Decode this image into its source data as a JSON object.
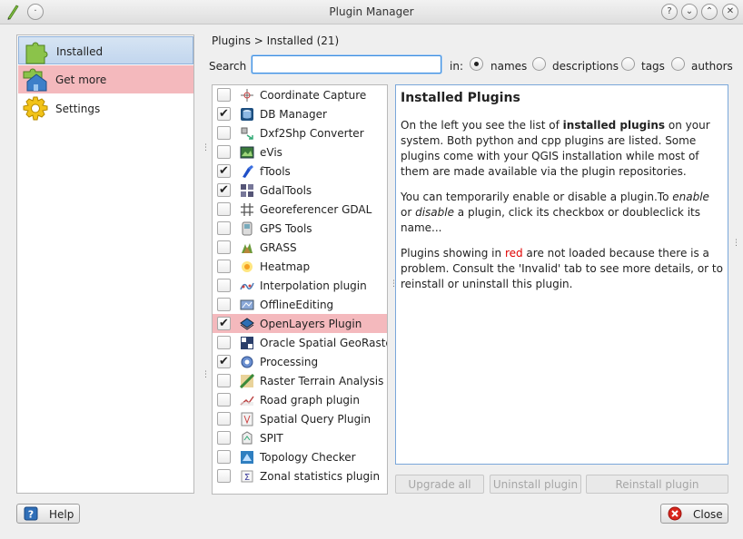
{
  "window": {
    "title": "Plugin Manager",
    "help_btn": "?",
    "min_btn": "⌄",
    "max_btn": "⌃",
    "close_btn": "✕",
    "menu_btn": "·"
  },
  "nav": {
    "items": [
      {
        "label": "Installed",
        "icon": "puzzle-icon",
        "state": "selected"
      },
      {
        "label": "Get more",
        "icon": "puzzle-house-icon",
        "state": "highlight"
      },
      {
        "label": "Settings",
        "icon": "gear-icon",
        "state": "normal"
      }
    ]
  },
  "breadcrumb": "Plugins > Installed (21)",
  "search": {
    "label": "Search",
    "value": "",
    "in_label": "in:",
    "options": [
      {
        "label": "names",
        "selected": true
      },
      {
        "label": "descriptions",
        "selected": false
      },
      {
        "label": "tags",
        "selected": false
      },
      {
        "label": "authors",
        "selected": false
      }
    ]
  },
  "plugins": [
    {
      "name": "Coordinate Capture",
      "checked": false,
      "icon": "crosshair-icon"
    },
    {
      "name": "DB Manager",
      "checked": true,
      "icon": "database-icon"
    },
    {
      "name": "Dxf2Shp Converter",
      "checked": false,
      "icon": "dxf-convert-icon"
    },
    {
      "name": "eVis",
      "checked": false,
      "icon": "evis-icon"
    },
    {
      "name": "fTools",
      "checked": true,
      "icon": "ftools-icon"
    },
    {
      "name": "GdalTools",
      "checked": true,
      "icon": "gdal-icon"
    },
    {
      "name": "Georeferencer GDAL",
      "checked": false,
      "icon": "georeferencer-icon"
    },
    {
      "name": "GPS Tools",
      "checked": false,
      "icon": "gps-icon"
    },
    {
      "name": "GRASS",
      "checked": false,
      "icon": "grass-icon"
    },
    {
      "name": "Heatmap",
      "checked": false,
      "icon": "heatmap-icon"
    },
    {
      "name": "Interpolation plugin",
      "checked": false,
      "icon": "interpolation-icon"
    },
    {
      "name": "OfflineEditing",
      "checked": false,
      "icon": "offline-editing-icon"
    },
    {
      "name": "OpenLayers Plugin",
      "checked": true,
      "icon": "openlayers-icon",
      "invalid": true
    },
    {
      "name": "Oracle Spatial GeoRaster",
      "checked": false,
      "icon": "oracle-icon"
    },
    {
      "name": "Processing",
      "checked": true,
      "icon": "processing-gear-icon"
    },
    {
      "name": "Raster Terrain Analysis ...",
      "checked": false,
      "icon": "terrain-icon"
    },
    {
      "name": "Road graph plugin",
      "checked": false,
      "icon": "road-graph-icon"
    },
    {
      "name": "Spatial Query Plugin",
      "checked": false,
      "icon": "spatial-query-icon"
    },
    {
      "name": "SPIT",
      "checked": false,
      "icon": "spit-icon"
    },
    {
      "name": "Topology Checker",
      "checked": false,
      "icon": "topology-icon"
    },
    {
      "name": "Zonal statistics plugin",
      "checked": false,
      "icon": "zonal-stats-icon"
    }
  ],
  "details": {
    "heading": "Installed Plugins",
    "p1_a": "On the left you see the list of ",
    "p1_b": "installed plugins",
    "p1_c": " on your system. Both python and cpp plugins are listed. Some plugins come with your QGIS installation while most of them are made available via the plugin repositories.",
    "p2_a": "You can temporarily enable or disable a plugin.To ",
    "p2_b": "enable",
    "p2_c": " or ",
    "p2_d": "disable",
    "p2_e": " a plugin, click its checkbox or doubleclick its name...",
    "p3_a": "Plugins showing in ",
    "p3_b": "red",
    "p3_c": " are not loaded because there is a problem. Consult the 'Invalid' tab to see more details, or to reinstall or uninstall this plugin."
  },
  "actions": {
    "upgrade_all": "Upgrade all",
    "uninstall": "Uninstall plugin",
    "reinstall": "Reinstall plugin"
  },
  "footer": {
    "help": "Help",
    "close": "Close"
  },
  "colors": {
    "invalid_row": "#f4b9bd",
    "selection": "#c2d6ee",
    "focus": "#3d8ee0"
  }
}
